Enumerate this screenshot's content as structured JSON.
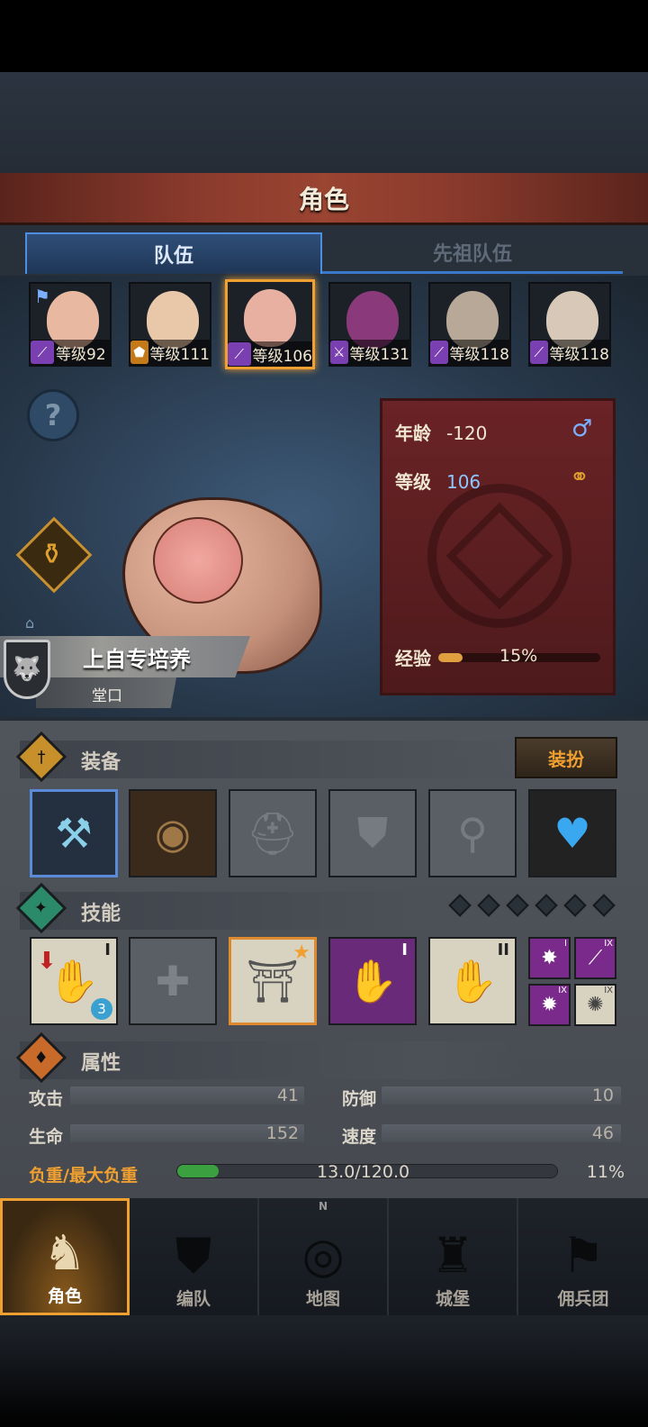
{
  "screen_title": "角色",
  "tabs": [
    {
      "label": "队伍",
      "active": true
    },
    {
      "label": "先祖队伍",
      "active": false
    }
  ],
  "roster": [
    {
      "level": "等级92",
      "class": "purple",
      "icon": "staff-icon",
      "flag": true,
      "face": "#e8b8a0"
    },
    {
      "level": "等级111",
      "class": "orange",
      "icon": "shield-icon",
      "flag": false,
      "face": "#e8c8a8"
    },
    {
      "level": "等级106",
      "class": "purple",
      "icon": "staff-icon",
      "flag": false,
      "face": "#e8b0a0",
      "selected": true
    },
    {
      "level": "等级131",
      "class": "purple",
      "icon": "sword-icon",
      "flag": false,
      "face": "#8a3a7a"
    },
    {
      "level": "等级118",
      "class": "purple",
      "icon": "staff-icon",
      "flag": false,
      "face": "#b8a898"
    },
    {
      "level": "等级118",
      "class": "purple",
      "icon": "staff-icon",
      "flag": false,
      "face": "#d8c8b8"
    }
  ],
  "character": {
    "name": "上自专培养",
    "guild": "堂口",
    "age_label": "年龄",
    "age_value": "-120",
    "level_label": "等级",
    "level_value": "106",
    "exp_label": "经验",
    "exp_percent": "15%",
    "exp_fraction": 0.15
  },
  "equipment": {
    "title": "装备",
    "dress_button": "装扮"
  },
  "skills": {
    "title": "技能",
    "tiers": [
      "I",
      "II",
      "I",
      "II",
      "I",
      "IX",
      "IX",
      "IX"
    ],
    "badge": "3"
  },
  "attributes": {
    "title": "属性",
    "attack_label": "攻击",
    "attack_value": "41",
    "defense_label": "防御",
    "defense_value": "10",
    "hp_label": "生命",
    "hp_value": "152",
    "speed_label": "速度",
    "speed_value": "46",
    "load_label": "负重/最大负重",
    "load_value": "13.0/120.0",
    "load_percent": "11%",
    "load_fraction": 0.11
  },
  "nav": [
    {
      "label": "角色",
      "active": true
    },
    {
      "label": "编队",
      "active": false
    },
    {
      "label": "地图",
      "active": false
    },
    {
      "label": "城堡",
      "active": false
    },
    {
      "label": "佣兵团",
      "active": false
    }
  ],
  "compass_letter": "N"
}
